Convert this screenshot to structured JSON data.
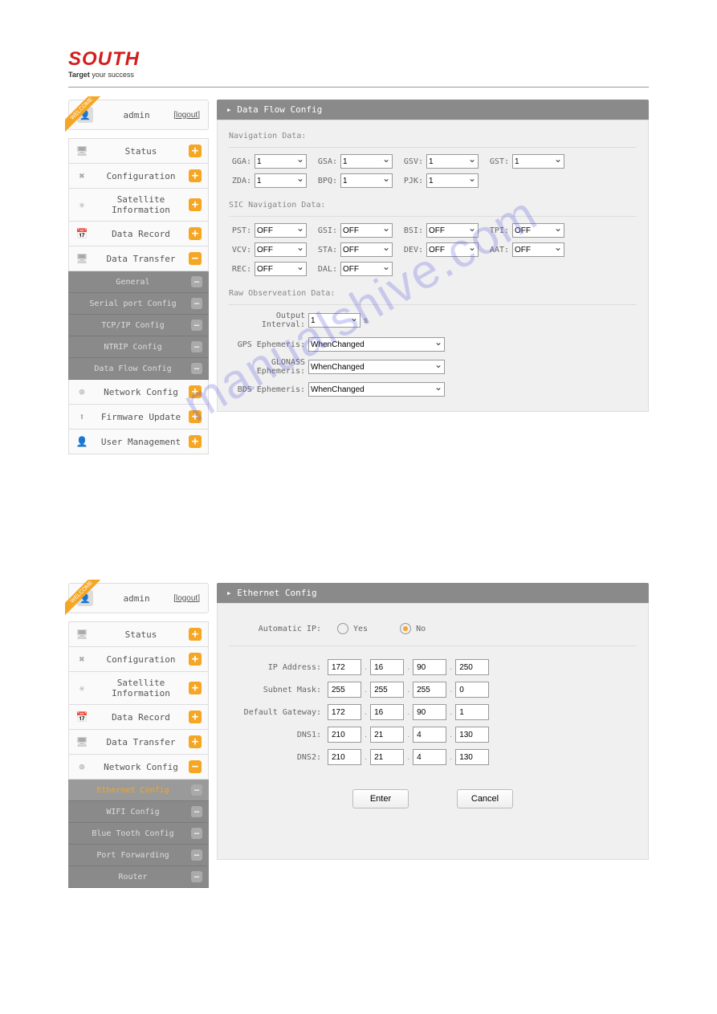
{
  "brand": {
    "name": "SOUTH",
    "tagline_bold": "Target",
    "tagline_rest": " your success"
  },
  "user": {
    "name": "admin",
    "logout": "[logout]"
  },
  "watermark": "manualshive.com",
  "screen1": {
    "title": "Data Flow Config",
    "nav": [
      {
        "icon": "monitor",
        "label": "Status",
        "toggle": "+"
      },
      {
        "icon": "wrench",
        "label": "Configuration",
        "toggle": "+"
      },
      {
        "icon": "sat",
        "label": "Satellite Information",
        "toggle": "+"
      },
      {
        "icon": "cal",
        "label": "Data Record",
        "toggle": "+"
      },
      {
        "icon": "monitor",
        "label": "Data Transfer",
        "toggle": "-"
      }
    ],
    "subnav": [
      {
        "label": "General"
      },
      {
        "label": "Serial port Config"
      },
      {
        "label": "TCP/IP Config"
      },
      {
        "label": "NTRIP Config"
      },
      {
        "label": "Data Flow Config"
      }
    ],
    "nav_after": [
      {
        "icon": "globe",
        "label": "Network Config",
        "toggle": "+"
      },
      {
        "icon": "up",
        "label": "Firmware Update",
        "toggle": "+"
      },
      {
        "icon": "user",
        "label": "User Management",
        "toggle": "+"
      }
    ],
    "sec1_title": "Navigation Data:",
    "sec1_fields": [
      {
        "k": "GGA:",
        "v": "1"
      },
      {
        "k": "GSA:",
        "v": "1"
      },
      {
        "k": "GSV:",
        "v": "1"
      },
      {
        "k": "GST:",
        "v": "1"
      },
      {
        "k": "ZDA:",
        "v": "1"
      },
      {
        "k": "BPQ:",
        "v": "1"
      },
      {
        "k": "PJK:",
        "v": "1"
      }
    ],
    "sec2_title": "SIC Navigation Data:",
    "sec2_fields": [
      {
        "k": "PST:",
        "v": "OFF"
      },
      {
        "k": "GSI:",
        "v": "OFF"
      },
      {
        "k": "BSI:",
        "v": "OFF"
      },
      {
        "k": "TPI:",
        "v": "OFF"
      },
      {
        "k": "VCV:",
        "v": "OFF"
      },
      {
        "k": "STA:",
        "v": "OFF"
      },
      {
        "k": "DEV:",
        "v": "OFF"
      },
      {
        "k": "AAT:",
        "v": "OFF"
      },
      {
        "k": "REC:",
        "v": "OFF"
      },
      {
        "k": "DAL:",
        "v": "OFF"
      }
    ],
    "sec3_title": "Raw Observeation Data:",
    "sec3_interval_label": "Output Interval:",
    "sec3_interval_val": "1",
    "sec3_interval_unit": "s",
    "sec3_eph": [
      {
        "k": "GPS Ephemeris:",
        "v": "WhenChanged"
      },
      {
        "k": "GLONASS Ephemeris:",
        "v": "WhenChanged"
      },
      {
        "k": "BDS Ephemeris:",
        "v": "WhenChanged"
      }
    ]
  },
  "screen2": {
    "title": "Ethernet Config",
    "nav": [
      {
        "icon": "monitor",
        "label": "Status",
        "toggle": "+"
      },
      {
        "icon": "wrench",
        "label": "Configuration",
        "toggle": "+"
      },
      {
        "icon": "sat",
        "label": "Satellite Information",
        "toggle": "+"
      },
      {
        "icon": "cal",
        "label": "Data Record",
        "toggle": "+"
      },
      {
        "icon": "monitor",
        "label": "Data Transfer",
        "toggle": "+"
      },
      {
        "icon": "globe",
        "label": "Network Config",
        "toggle": "-"
      }
    ],
    "subnav": [
      {
        "label": "Ethernet Config",
        "active": true
      },
      {
        "label": "WIFI Config"
      },
      {
        "label": "Blue Tooth Config"
      },
      {
        "label": "Port Forwarding"
      },
      {
        "label": "Router"
      }
    ],
    "auto_ip_label": "Automatic IP:",
    "yes": "Yes",
    "no": "No",
    "ip_rows": [
      {
        "k": "IP Address:",
        "v": [
          "172",
          "16",
          "90",
          "250"
        ]
      },
      {
        "k": "Subnet Mask:",
        "v": [
          "255",
          "255",
          "255",
          "0"
        ]
      },
      {
        "k": "Default Gateway:",
        "v": [
          "172",
          "16",
          "90",
          "1"
        ]
      },
      {
        "k": "DNS1:",
        "v": [
          "210",
          "21",
          "4",
          "130"
        ]
      },
      {
        "k": "DNS2:",
        "v": [
          "210",
          "21",
          "4",
          "130"
        ]
      }
    ],
    "enter": "Enter",
    "cancel": "Cancel"
  }
}
